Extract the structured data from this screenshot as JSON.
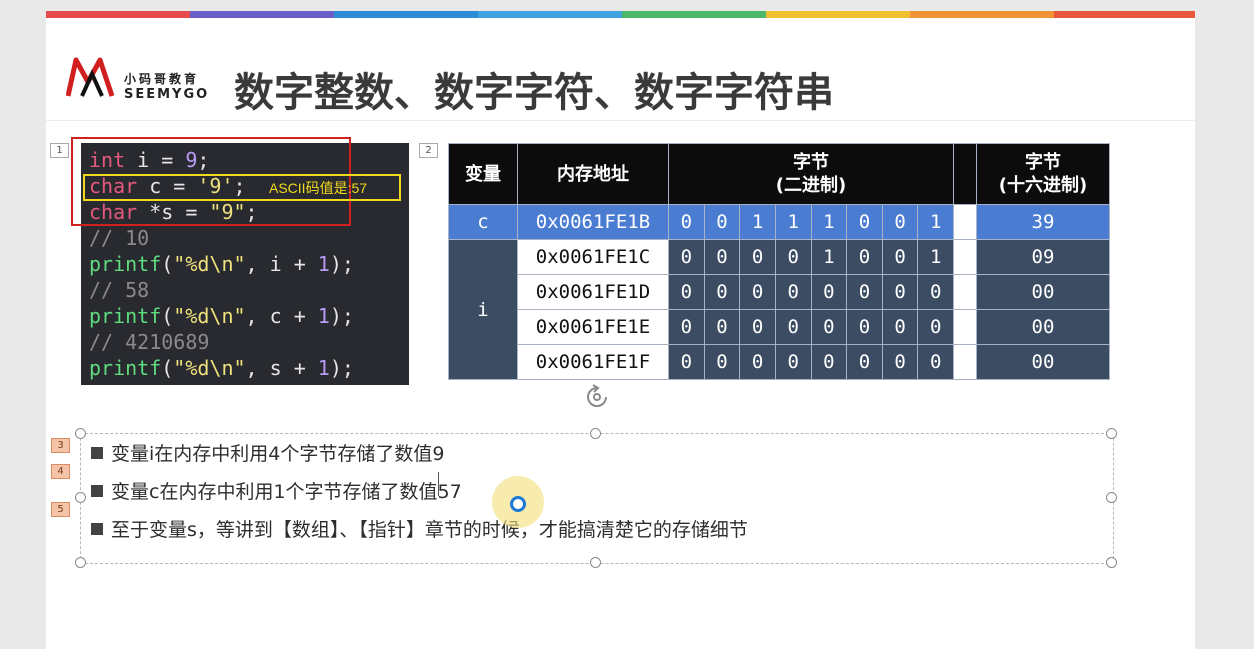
{
  "header": {
    "logo_cn": "小码哥教育",
    "logo_en": "SEEMYGO",
    "title": "数字整数、数字字符、数字字符串"
  },
  "tags": [
    "1",
    "2",
    "3",
    "4",
    "5"
  ],
  "code_annotation": "ASCII码值是:57",
  "code_lines": {
    "l1": [
      "int",
      " i = ",
      "9",
      ";"
    ],
    "l2": [
      "char",
      " c = ",
      "'9'",
      ";"
    ],
    "l3": [
      "char",
      " *s = ",
      "\"9\"",
      ";"
    ],
    "l4": "// 10",
    "l5": [
      "printf",
      "(",
      "\"%d\\n\"",
      ", i + ",
      "1",
      ");"
    ],
    "l6": "// 58",
    "l7": [
      "printf",
      "(",
      "\"%d\\n\"",
      ", c + ",
      "1",
      ");"
    ],
    "l8": "// 4210689",
    "l9": [
      "printf",
      "(",
      "\"%d\\n\"",
      ", s + ",
      "1",
      ");"
    ]
  },
  "table": {
    "col_var": "变量",
    "col_addr": "内存地址",
    "col_bin": "字节\n(二进制)",
    "col_hex": "字节\n(十六进制)",
    "var_c": "c",
    "var_i": "i",
    "rows": [
      {
        "addr": "0x0061FE1B",
        "bits": [
          "0",
          "0",
          "1",
          "1",
          "1",
          "0",
          "0",
          "1"
        ],
        "hex": "39"
      },
      {
        "addr": "0x0061FE1C",
        "bits": [
          "0",
          "0",
          "0",
          "0",
          "1",
          "0",
          "0",
          "1"
        ],
        "hex": "09"
      },
      {
        "addr": "0x0061FE1D",
        "bits": [
          "0",
          "0",
          "0",
          "0",
          "0",
          "0",
          "0",
          "0"
        ],
        "hex": "00"
      },
      {
        "addr": "0x0061FE1E",
        "bits": [
          "0",
          "0",
          "0",
          "0",
          "0",
          "0",
          "0",
          "0"
        ],
        "hex": "00"
      },
      {
        "addr": "0x0061FE1F",
        "bits": [
          "0",
          "0",
          "0",
          "0",
          "0",
          "0",
          "0",
          "0"
        ],
        "hex": "00"
      }
    ]
  },
  "bullets": [
    "变量i在内存中利用4个字节存储了数值9",
    "变量c在内存中利用1个字节存储了数值57",
    "至于变量s，等讲到【数组】、【指针】章节的时候，才能搞清楚它的存储细节"
  ],
  "colors": {
    "bar": [
      "#e74c4c",
      "#6a5fc9",
      "#2e8bd6",
      "#3fa3e0",
      "#4cb86a",
      "#f0c030",
      "#f29436",
      "#e8573b"
    ],
    "table_dark": "#3b4c63",
    "table_highlight": "#4a7cd2"
  }
}
